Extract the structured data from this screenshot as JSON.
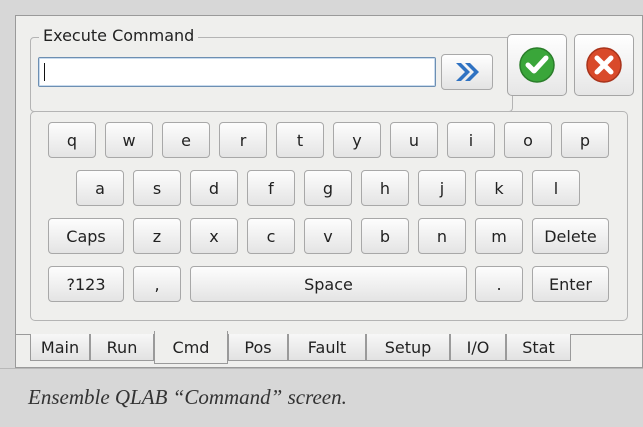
{
  "command_group": {
    "title": "Execute Command",
    "input_value": ""
  },
  "buttons": {
    "send_icon": "double-chevron-right-icon",
    "ok_icon": "green-check-icon",
    "cancel_icon": "red-x-icon"
  },
  "keyboard": {
    "row1": [
      "q",
      "w",
      "e",
      "r",
      "t",
      "y",
      "u",
      "i",
      "o",
      "p"
    ],
    "row2": [
      "a",
      "s",
      "d",
      "f",
      "g",
      "h",
      "j",
      "k",
      "l"
    ],
    "row3": [
      "Caps",
      "z",
      "x",
      "c",
      "v",
      "b",
      "n",
      "m",
      "Delete"
    ],
    "row4": [
      "?123",
      ",",
      "Space",
      ".",
      "Enter"
    ]
  },
  "tabs": [
    {
      "label": "Main"
    },
    {
      "label": "Run"
    },
    {
      "label": "Cmd",
      "active": true
    },
    {
      "label": "Pos"
    },
    {
      "label": "Fault"
    },
    {
      "label": "Setup"
    },
    {
      "label": "I/O"
    },
    {
      "label": "Stat"
    }
  ],
  "caption": "Ensemble QLAB “Command” screen.",
  "colors": {
    "accent_blue": "#2f72c2",
    "ok_green": "#3aa63a",
    "cancel_red": "#d94a2a"
  }
}
